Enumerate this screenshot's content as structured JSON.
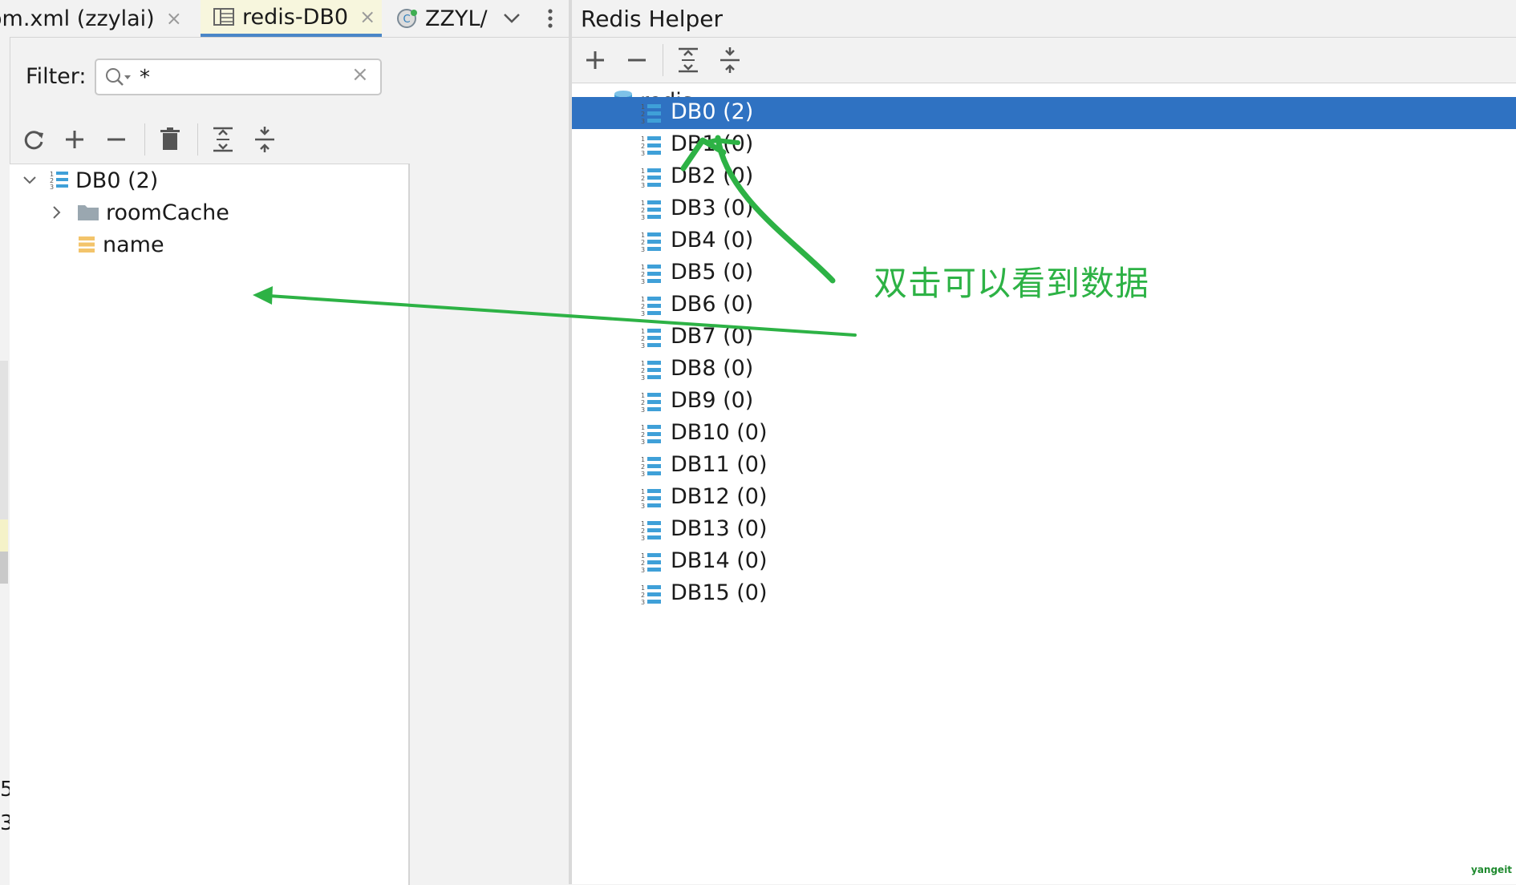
{
  "left_tabs": [
    {
      "label": "om.xml (zzylai)",
      "close": "×"
    },
    {
      "label": "redis-DB0",
      "close": "×"
    },
    {
      "label": "ZZYL/"
    }
  ],
  "filter": {
    "label": "Filter:",
    "value": "*",
    "clear": "×"
  },
  "left_tree": {
    "root": {
      "label": "DB0 (2)",
      "expanded": true
    },
    "children": [
      {
        "label": "roomCache",
        "icon": "folder-icon",
        "expandable": true
      },
      {
        "label": "name",
        "icon": "string-key-icon",
        "expandable": false
      }
    ]
  },
  "left_gutter": {
    "line_a": "5",
    "line_b": "3"
  },
  "right_panel": {
    "title": "Redis Helper",
    "root": {
      "label": "redis",
      "expanded": true
    },
    "databases": [
      {
        "label": "DB0 (2)",
        "selected": true
      },
      {
        "label": "DB1 (0)"
      },
      {
        "label": "DB2 (0)"
      },
      {
        "label": "DB3 (0)"
      },
      {
        "label": "DB4 (0)"
      },
      {
        "label": "DB5 (0)"
      },
      {
        "label": "DB6 (0)"
      },
      {
        "label": "DB7 (0)"
      },
      {
        "label": "DB8 (0)"
      },
      {
        "label": "DB9 (0)"
      },
      {
        "label": "DB10 (0)"
      },
      {
        "label": "DB11 (0)"
      },
      {
        "label": "DB12 (0)"
      },
      {
        "label": "DB13 (0)"
      },
      {
        "label": "DB14 (0)"
      },
      {
        "label": "DB15 (0)"
      }
    ]
  },
  "annotation": {
    "text": "双击可以看到数据",
    "color": "#2db245"
  },
  "watermark": "yangeit",
  "colors": {
    "selection": "#2f72c2",
    "active_tab": "#f7f6dd",
    "tab_underline": "#4a86c7",
    "db_icon": "#3fa0d8",
    "folder": "#9aa7b0",
    "key": "#f3c46b"
  }
}
